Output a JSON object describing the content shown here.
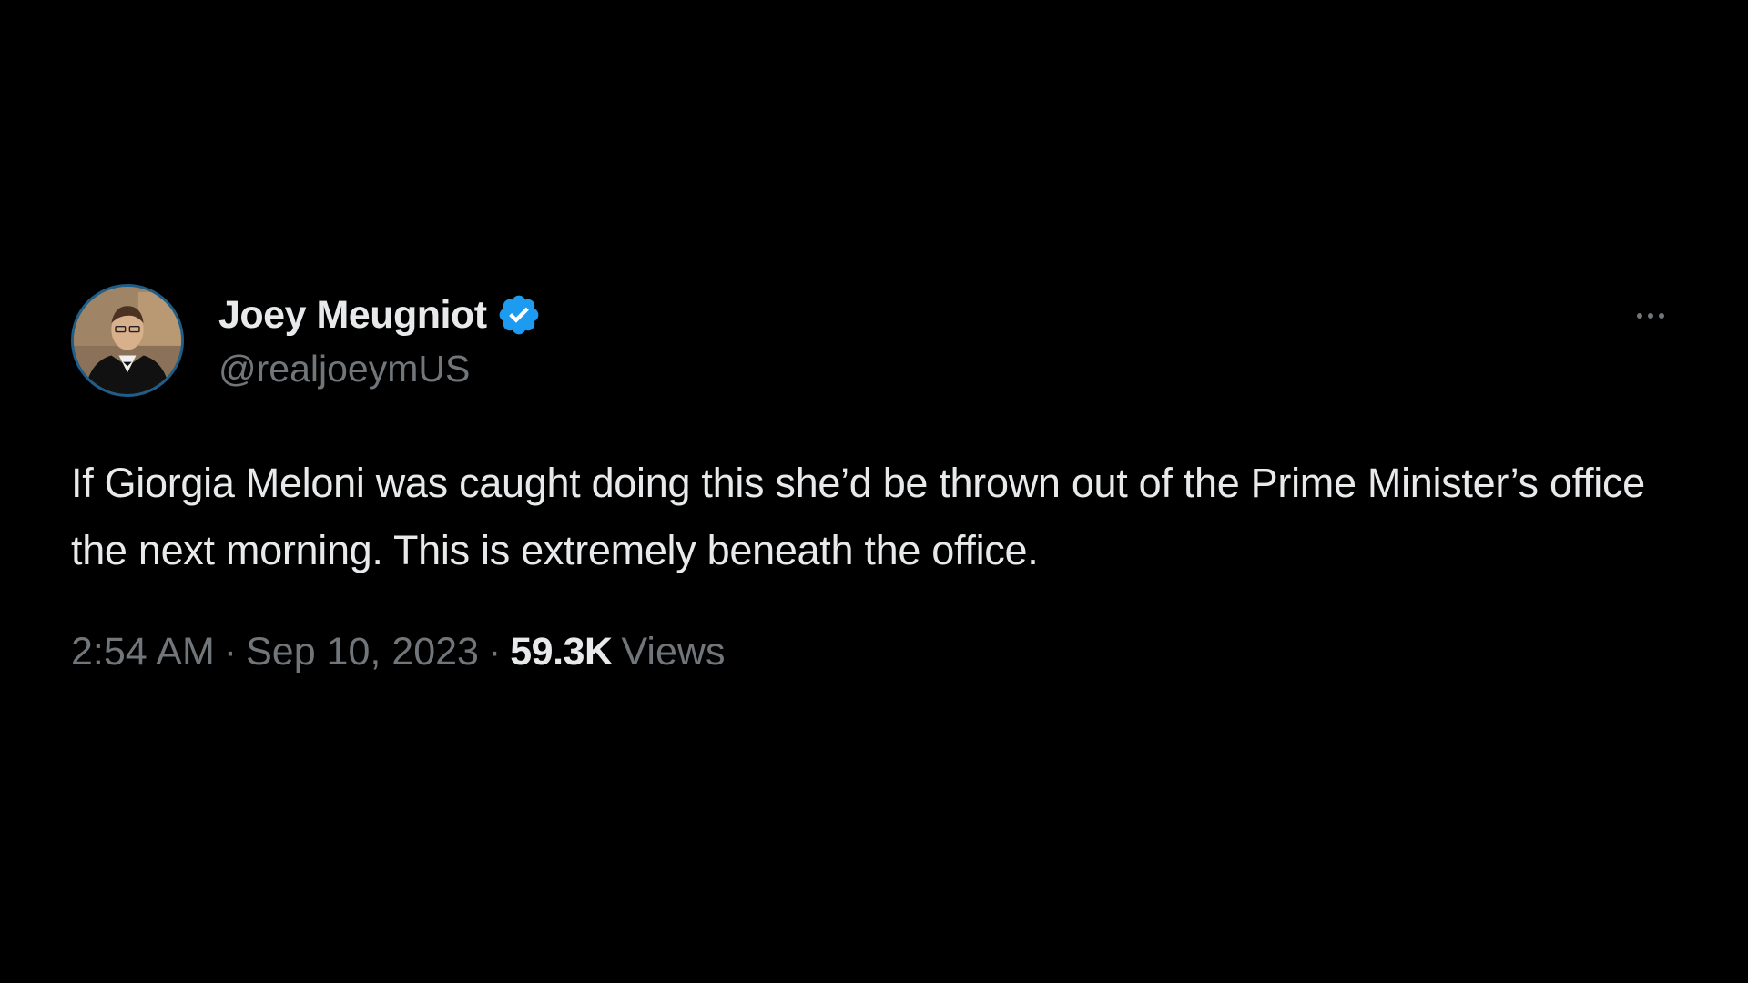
{
  "tweet": {
    "author": {
      "display_name": "Joey Meugniot",
      "handle": "@realjoeymUS",
      "verified": true,
      "avatar_icon": "profile-photo",
      "verified_icon": "verified-badge-icon",
      "verified_color": "#1d9bf0"
    },
    "text": "If Giorgia Meloni was caught doing this she’d be thrown out of the Prime Minister’s office the next morning. This is extremely beneath the office.",
    "time": "2:54 AM",
    "separator": "·",
    "date": "Sep 10, 2023",
    "views_count": "59.3K",
    "views_label": "Views",
    "more_icon": "more-options-icon"
  },
  "colors": {
    "background": "#000000",
    "primary_text": "#e7e9ea",
    "secondary_text": "#71767b"
  }
}
